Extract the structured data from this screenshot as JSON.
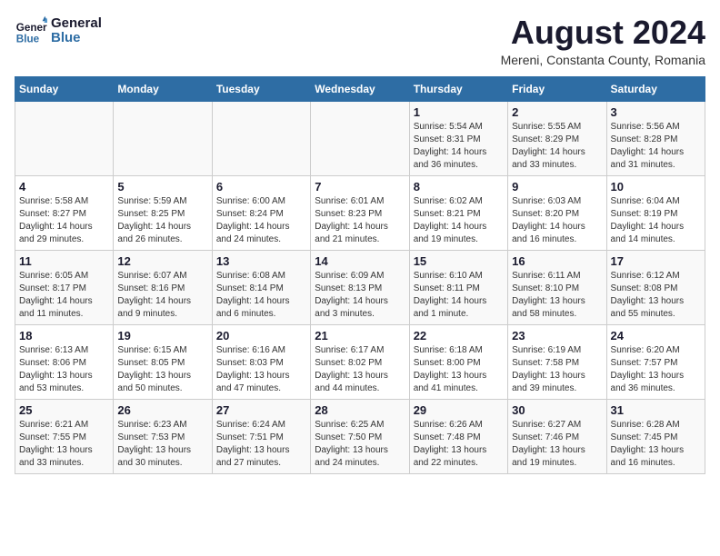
{
  "header": {
    "logo_line1": "General",
    "logo_line2": "Blue",
    "main_title": "August 2024",
    "subtitle": "Mereni, Constanta County, Romania"
  },
  "weekdays": [
    "Sunday",
    "Monday",
    "Tuesday",
    "Wednesday",
    "Thursday",
    "Friday",
    "Saturday"
  ],
  "weeks": [
    [
      {
        "date": "",
        "info": ""
      },
      {
        "date": "",
        "info": ""
      },
      {
        "date": "",
        "info": ""
      },
      {
        "date": "",
        "info": ""
      },
      {
        "date": "1",
        "info": "Sunrise: 5:54 AM\nSunset: 8:31 PM\nDaylight: 14 hours\nand 36 minutes."
      },
      {
        "date": "2",
        "info": "Sunrise: 5:55 AM\nSunset: 8:29 PM\nDaylight: 14 hours\nand 33 minutes."
      },
      {
        "date": "3",
        "info": "Sunrise: 5:56 AM\nSunset: 8:28 PM\nDaylight: 14 hours\nand 31 minutes."
      }
    ],
    [
      {
        "date": "4",
        "info": "Sunrise: 5:58 AM\nSunset: 8:27 PM\nDaylight: 14 hours\nand 29 minutes."
      },
      {
        "date": "5",
        "info": "Sunrise: 5:59 AM\nSunset: 8:25 PM\nDaylight: 14 hours\nand 26 minutes."
      },
      {
        "date": "6",
        "info": "Sunrise: 6:00 AM\nSunset: 8:24 PM\nDaylight: 14 hours\nand 24 minutes."
      },
      {
        "date": "7",
        "info": "Sunrise: 6:01 AM\nSunset: 8:23 PM\nDaylight: 14 hours\nand 21 minutes."
      },
      {
        "date": "8",
        "info": "Sunrise: 6:02 AM\nSunset: 8:21 PM\nDaylight: 14 hours\nand 19 minutes."
      },
      {
        "date": "9",
        "info": "Sunrise: 6:03 AM\nSunset: 8:20 PM\nDaylight: 14 hours\nand 16 minutes."
      },
      {
        "date": "10",
        "info": "Sunrise: 6:04 AM\nSunset: 8:19 PM\nDaylight: 14 hours\nand 14 minutes."
      }
    ],
    [
      {
        "date": "11",
        "info": "Sunrise: 6:05 AM\nSunset: 8:17 PM\nDaylight: 14 hours\nand 11 minutes."
      },
      {
        "date": "12",
        "info": "Sunrise: 6:07 AM\nSunset: 8:16 PM\nDaylight: 14 hours\nand 9 minutes."
      },
      {
        "date": "13",
        "info": "Sunrise: 6:08 AM\nSunset: 8:14 PM\nDaylight: 14 hours\nand 6 minutes."
      },
      {
        "date": "14",
        "info": "Sunrise: 6:09 AM\nSunset: 8:13 PM\nDaylight: 14 hours\nand 3 minutes."
      },
      {
        "date": "15",
        "info": "Sunrise: 6:10 AM\nSunset: 8:11 PM\nDaylight: 14 hours\nand 1 minute."
      },
      {
        "date": "16",
        "info": "Sunrise: 6:11 AM\nSunset: 8:10 PM\nDaylight: 13 hours\nand 58 minutes."
      },
      {
        "date": "17",
        "info": "Sunrise: 6:12 AM\nSunset: 8:08 PM\nDaylight: 13 hours\nand 55 minutes."
      }
    ],
    [
      {
        "date": "18",
        "info": "Sunrise: 6:13 AM\nSunset: 8:06 PM\nDaylight: 13 hours\nand 53 minutes."
      },
      {
        "date": "19",
        "info": "Sunrise: 6:15 AM\nSunset: 8:05 PM\nDaylight: 13 hours\nand 50 minutes."
      },
      {
        "date": "20",
        "info": "Sunrise: 6:16 AM\nSunset: 8:03 PM\nDaylight: 13 hours\nand 47 minutes."
      },
      {
        "date": "21",
        "info": "Sunrise: 6:17 AM\nSunset: 8:02 PM\nDaylight: 13 hours\nand 44 minutes."
      },
      {
        "date": "22",
        "info": "Sunrise: 6:18 AM\nSunset: 8:00 PM\nDaylight: 13 hours\nand 41 minutes."
      },
      {
        "date": "23",
        "info": "Sunrise: 6:19 AM\nSunset: 7:58 PM\nDaylight: 13 hours\nand 39 minutes."
      },
      {
        "date": "24",
        "info": "Sunrise: 6:20 AM\nSunset: 7:57 PM\nDaylight: 13 hours\nand 36 minutes."
      }
    ],
    [
      {
        "date": "25",
        "info": "Sunrise: 6:21 AM\nSunset: 7:55 PM\nDaylight: 13 hours\nand 33 minutes."
      },
      {
        "date": "26",
        "info": "Sunrise: 6:23 AM\nSunset: 7:53 PM\nDaylight: 13 hours\nand 30 minutes."
      },
      {
        "date": "27",
        "info": "Sunrise: 6:24 AM\nSunset: 7:51 PM\nDaylight: 13 hours\nand 27 minutes."
      },
      {
        "date": "28",
        "info": "Sunrise: 6:25 AM\nSunset: 7:50 PM\nDaylight: 13 hours\nand 24 minutes."
      },
      {
        "date": "29",
        "info": "Sunrise: 6:26 AM\nSunset: 7:48 PM\nDaylight: 13 hours\nand 22 minutes."
      },
      {
        "date": "30",
        "info": "Sunrise: 6:27 AM\nSunset: 7:46 PM\nDaylight: 13 hours\nand 19 minutes."
      },
      {
        "date": "31",
        "info": "Sunrise: 6:28 AM\nSunset: 7:45 PM\nDaylight: 13 hours\nand 16 minutes."
      }
    ]
  ]
}
